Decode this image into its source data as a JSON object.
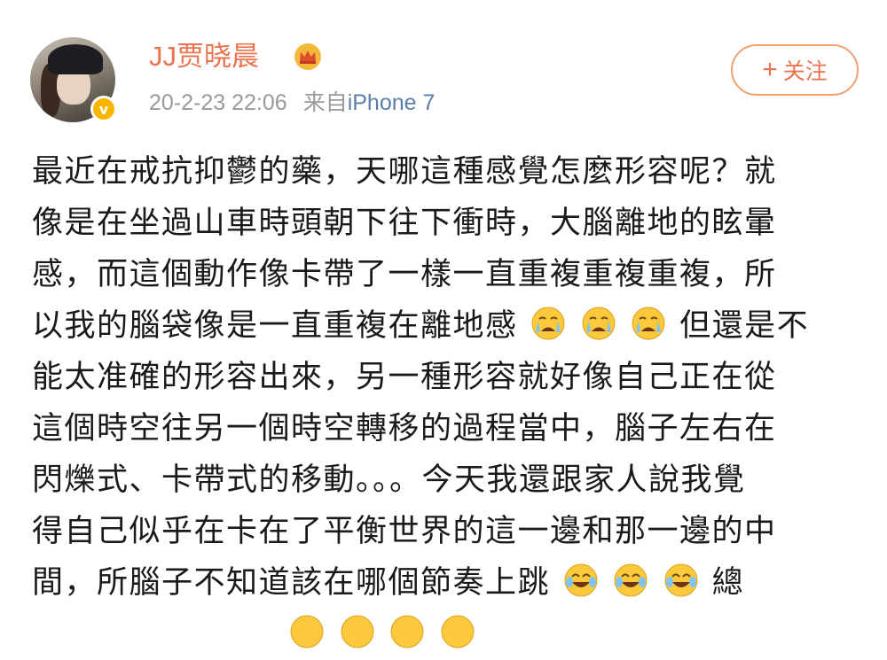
{
  "user": {
    "name": "JJ贾晓晨",
    "time": "20-2-23 22:06",
    "source_prefix": "来自",
    "device": "iPhone 7"
  },
  "follow_button": {
    "plus": "+",
    "label": "关注"
  },
  "post": {
    "lines": [
      "最近在戒抗抑鬱的藥，天哪這種感覺怎麼形容呢？就",
      "像是在坐過山車時頭朝下往下衝時，大腦離地的眩暈",
      "感，而這個動作像卡帶了一樣一直重複重複重複，所",
      "以我的腦袋像是一直重複在離地感",
      "但還是不",
      "能太准確的形容出來，另一種形容就好像自己正在從",
      "這個時空往另一個時空轉移的過程當中，腦子左右在",
      "閃爍式、卡帶式的移動。。。今天我還跟家人說我覺",
      "得自己似乎在卡在了平衡世界的這一邊和那一邊的中",
      "間，所腦子不知道該在哪個節奏上跳",
      "總"
    ],
    "emoji": {
      "crying": "crying-face",
      "laughing": "tears-of-joy-face"
    }
  },
  "colors": {
    "name": "#eb7350",
    "device": "#5a7fa8",
    "meta": "#9a9a9a",
    "follow_border": "#f0a16f",
    "badge": "#f7b500"
  }
}
